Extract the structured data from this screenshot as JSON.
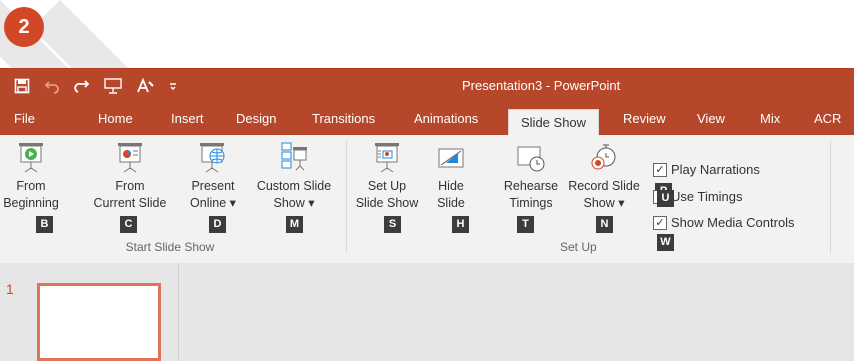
{
  "step": {
    "number": "2"
  },
  "window": {
    "title": "Presentation3 - PowerPoint"
  },
  "qat": [
    {
      "icon": "save-icon"
    },
    {
      "icon": "undo-icon"
    },
    {
      "icon": "redo-icon"
    },
    {
      "icon": "present-icon"
    },
    {
      "icon": "font-color-icon"
    },
    {
      "icon": "customize-icon"
    }
  ],
  "tabs": [
    "File",
    "Home",
    "Insert",
    "Design",
    "Transitions",
    "Animations",
    "Slide Show",
    "Review",
    "View",
    "Mix",
    "ACR"
  ],
  "active_tab": "Slide Show",
  "ribbon": {
    "groups": {
      "start": "Start Slide Show",
      "setup": "Set Up"
    },
    "buttons": {
      "from_beginning": {
        "line1": "From",
        "line2": "Beginning",
        "key": "B"
      },
      "from_current": {
        "line1": "From",
        "line2": "Current Slide",
        "key": "C"
      },
      "present_online": {
        "line1": "Present",
        "line2": "Online ▾",
        "key": "D"
      },
      "custom_show": {
        "line1": "Custom Slide",
        "line2": "Show ▾",
        "key": "M"
      },
      "set_up": {
        "line1": "Set Up",
        "line2": "Slide Show",
        "key": "S"
      },
      "hide_slide": {
        "line1": "Hide",
        "line2": "Slide",
        "key": "H"
      },
      "rehearse": {
        "line1": "Rehearse",
        "line2": "Timings",
        "key": "T"
      },
      "record": {
        "line1": "Record Slide",
        "line2": "Show ▾",
        "key": "N"
      }
    },
    "checks": {
      "narrations": {
        "label": "Play Narrations",
        "key": "P",
        "checked": true
      },
      "timings": {
        "label": "Use Timings",
        "key": "U",
        "checked": true
      },
      "media": {
        "label": "Show Media Controls",
        "key": "W",
        "checked": true
      }
    }
  },
  "slides": [
    {
      "number": "1"
    }
  ],
  "colors": {
    "accent": "#b7472a",
    "keytip": "#3c3c3c"
  }
}
